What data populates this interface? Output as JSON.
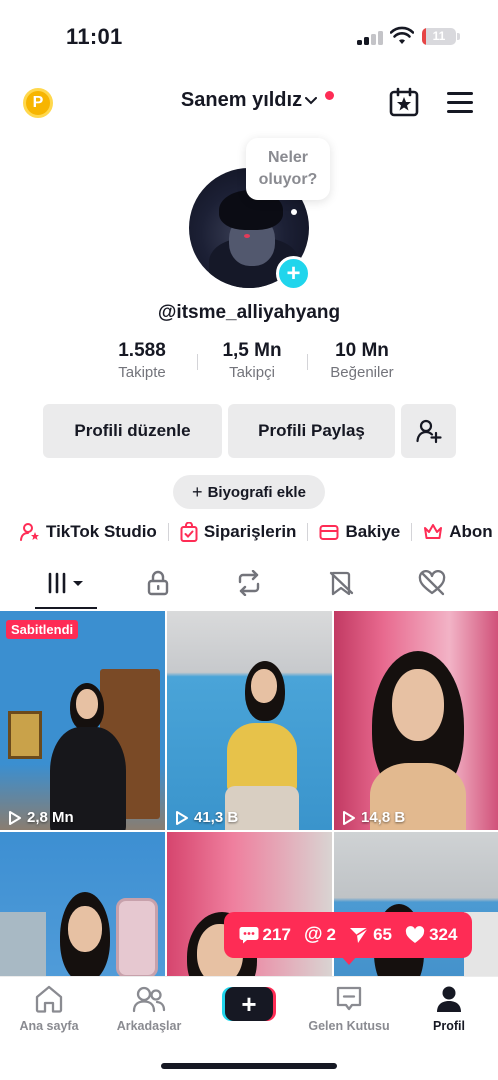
{
  "status_bar": {
    "time": "11:01",
    "battery": "11",
    "battery_level": 0.11
  },
  "header": {
    "coin_letter": "P",
    "title": "Sanem yıldız",
    "icons": [
      "coin-icon",
      "calendar-star-icon",
      "hamburger-menu-icon"
    ]
  },
  "profile": {
    "note_bubble": "Neler oluyor?",
    "handle": "@itsme_alliyahyang",
    "stats": [
      {
        "value": "1.588",
        "label": "Takipte"
      },
      {
        "value": "1,5 Mn",
        "label": "Takipçi"
      },
      {
        "value": "10 Mn",
        "label": "Beğeniler"
      }
    ]
  },
  "actions": {
    "edit_profile": "Profili düzenle",
    "share_profile": "Profili Paylaş",
    "add_bio": "Biyografi ekle"
  },
  "shortcuts": [
    {
      "label": "TikTok Studio",
      "icon": "person-star-icon"
    },
    {
      "label": "Siparişlerin",
      "icon": "order-bag-icon"
    },
    {
      "label": "Bakiye",
      "icon": "wallet-icon"
    },
    {
      "label": "Abon",
      "icon": "crown-icon"
    }
  ],
  "tabs": [
    "grid-icon",
    "lock-icon",
    "repost-icon",
    "bookmark-icon",
    "liked-heart-icon"
  ],
  "videos": [
    {
      "views": "2,8 Mn",
      "pinned_label": "Sabitlendi"
    },
    {
      "views": "41,3 B"
    },
    {
      "views": "14,8 B"
    },
    {
      "views": ""
    },
    {
      "views": ""
    },
    {
      "views": ""
    }
  ],
  "notifications": {
    "comments": "217",
    "mentions": "2",
    "shares": "65",
    "likes": "324"
  },
  "bottom_nav": {
    "home": "Ana sayfa",
    "friends": "Arkadaşlar",
    "inbox": "Gelen Kutusu",
    "profile": "Profil"
  },
  "colors": {
    "accent": "#fe2c55",
    "cyan": "#20d5ec",
    "text": "#161823",
    "muted": "#8a8b91",
    "button_bg": "#ebebec"
  }
}
